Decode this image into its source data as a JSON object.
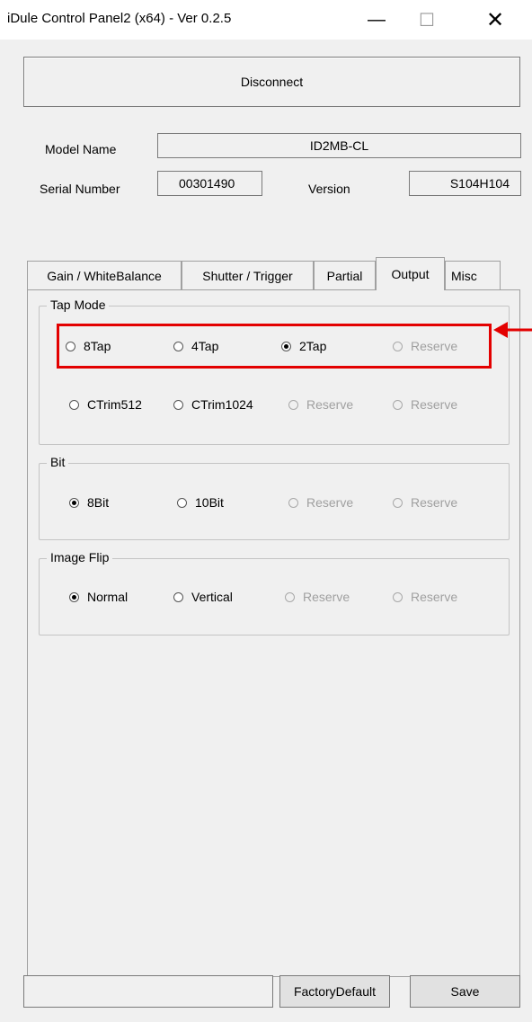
{
  "window": {
    "title": "iDule Control Panel2 (x64) - Ver 0.2.5",
    "minimize": "—",
    "maximize": "☐",
    "close": "✕"
  },
  "connection": {
    "button_label": "Disconnect"
  },
  "info": {
    "model_name_label": "Model Name",
    "model_name_value": "ID2MB-CL",
    "serial_number_label": "Serial Number",
    "serial_number_value": "00301490",
    "version_label": "Version",
    "version_value": "S104H104"
  },
  "tabs": [
    {
      "label": "Gain / WhiteBalance"
    },
    {
      "label": "Shutter / Trigger"
    },
    {
      "label": "Partial"
    },
    {
      "label": "Output",
      "active": true
    },
    {
      "label": "Misc"
    }
  ],
  "tap_mode": {
    "title": "Tap Mode",
    "row1": [
      {
        "label": "8Tap",
        "checked": false,
        "enabled": true
      },
      {
        "label": "4Tap",
        "checked": false,
        "enabled": true
      },
      {
        "label": "2Tap",
        "checked": true,
        "enabled": true
      },
      {
        "label": "Reserve",
        "checked": false,
        "enabled": false
      }
    ],
    "row2": [
      {
        "label": "CTrim512",
        "checked": false,
        "enabled": true
      },
      {
        "label": "CTrim1024",
        "checked": false,
        "enabled": true
      },
      {
        "label": "Reserve",
        "checked": false,
        "enabled": false
      },
      {
        "label": "Reserve",
        "checked": false,
        "enabled": false
      }
    ]
  },
  "bit": {
    "title": "Bit",
    "options": [
      {
        "label": "8Bit",
        "checked": true,
        "enabled": true
      },
      {
        "label": "10Bit",
        "checked": false,
        "enabled": true
      },
      {
        "label": "Reserve",
        "checked": false,
        "enabled": false
      },
      {
        "label": "Reserve",
        "checked": false,
        "enabled": false
      }
    ]
  },
  "image_flip": {
    "title": "Image Flip",
    "options": [
      {
        "label": "Normal",
        "checked": true,
        "enabled": true
      },
      {
        "label": "Vertical",
        "checked": false,
        "enabled": true
      },
      {
        "label": "Reserve",
        "checked": false,
        "enabled": false
      },
      {
        "label": "Reserve",
        "checked": false,
        "enabled": false
      }
    ]
  },
  "footer": {
    "status_text": "",
    "factory_default_label": "FactoryDefault",
    "save_label": "Save"
  },
  "annotation": {
    "highlight_color": "#e30000"
  }
}
